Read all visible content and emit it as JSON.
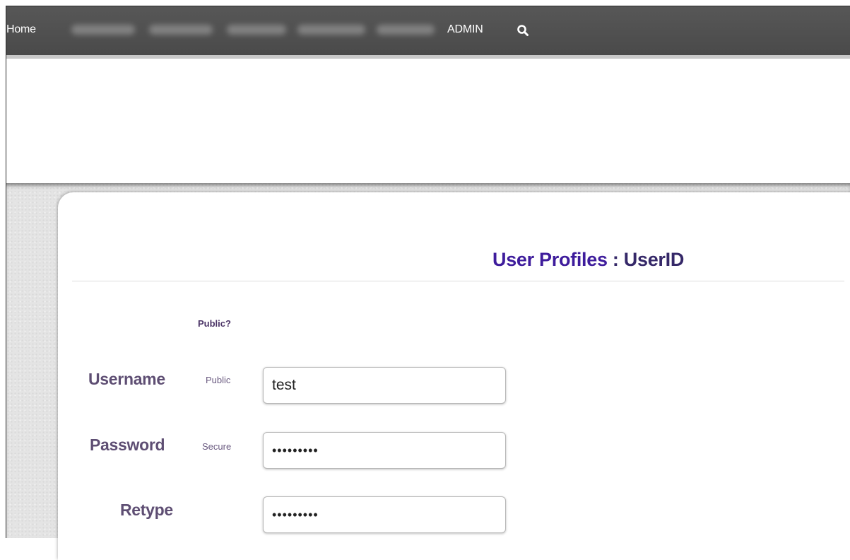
{
  "nav": {
    "home": "Home",
    "admin": "ADMIN",
    "blurred_count": 5
  },
  "page": {
    "title_main": "User Profiles",
    "title_sep": " : ",
    "title_sub": "UserID"
  },
  "form": {
    "visibility_header": "Public?",
    "username": {
      "label": "Username",
      "visibility": "Public",
      "value": "test"
    },
    "password": {
      "label": "Password",
      "visibility": "Secure",
      "value": "•••••••••"
    },
    "retype": {
      "label": "Retype",
      "value": "•••••••••"
    }
  },
  "colors": {
    "navbar": "#4f4f4f",
    "title_accent": "#3e1c9c",
    "label": "#5e4e73"
  }
}
